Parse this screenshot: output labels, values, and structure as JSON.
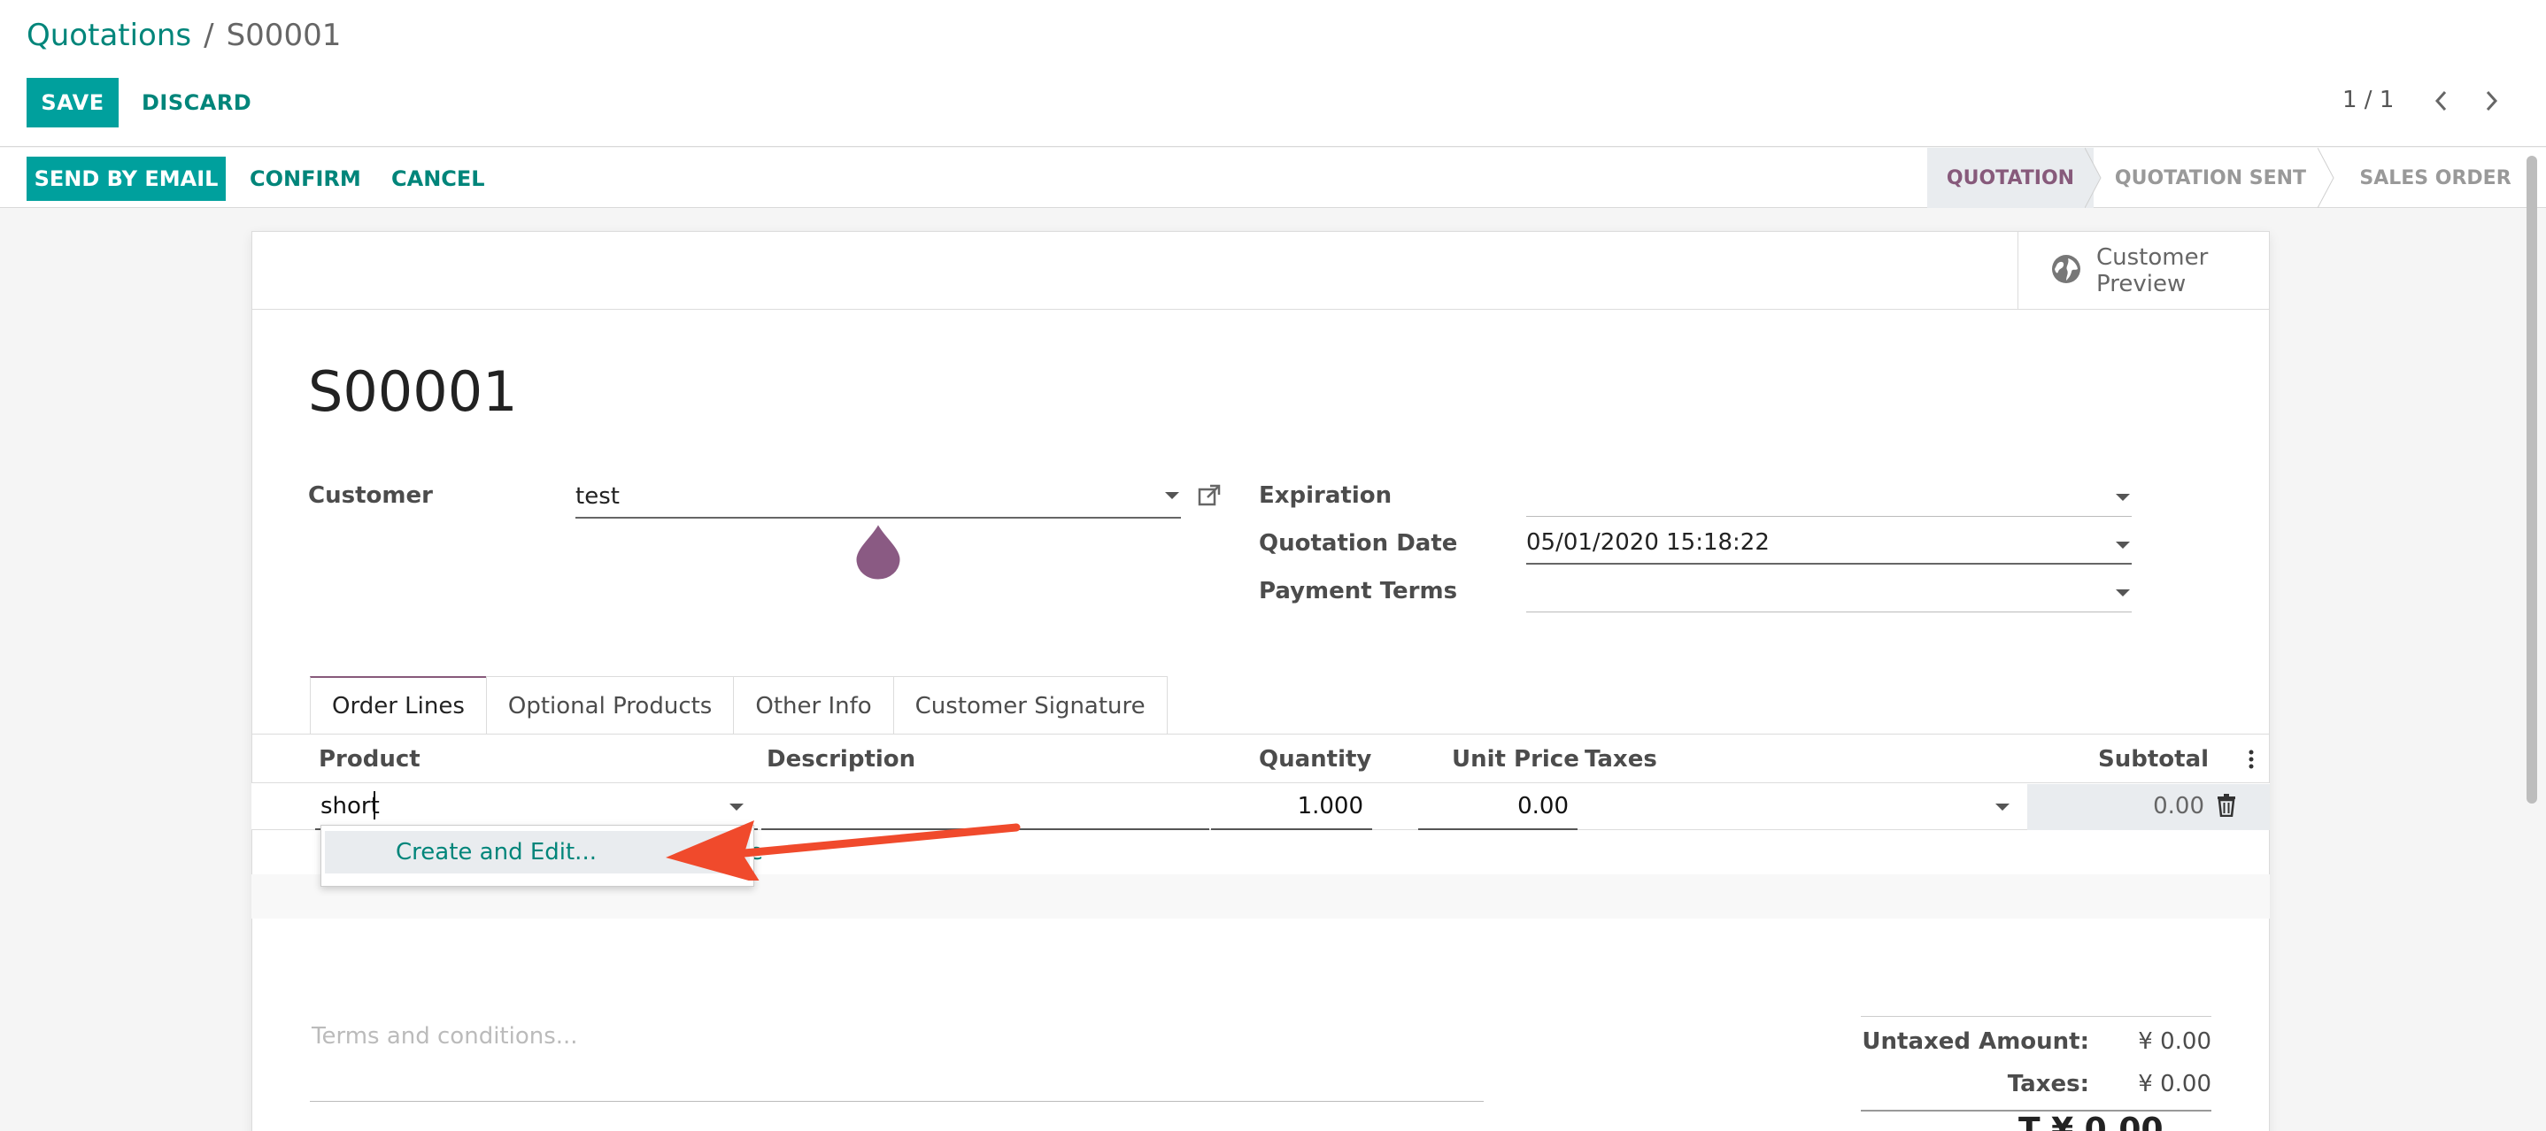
{
  "breadcrumb": {
    "parent": "Quotations",
    "separator": "/",
    "current": "S00001"
  },
  "toolbar": {
    "save": "SAVE",
    "discard": "DISCARD"
  },
  "pager": {
    "value": "1 / 1"
  },
  "actions": {
    "send_by_email": "SEND BY EMAIL",
    "confirm": "CONFIRM",
    "cancel": "CANCEL"
  },
  "stages": [
    {
      "label": "QUOTATION",
      "active": true
    },
    {
      "label": "QUOTATION SENT",
      "active": false
    },
    {
      "label": "SALES ORDER",
      "active": false
    }
  ],
  "smart_button": {
    "label_line1": "Customer",
    "label_line2": "Preview",
    "icon": "globe-icon"
  },
  "document": {
    "title": "S00001"
  },
  "form": {
    "customer_label": "Customer",
    "customer_value": "test",
    "expiration_label": "Expiration",
    "expiration_value": "",
    "quotation_date_label": "Quotation Date",
    "quotation_date_value": "05/01/2020 15:18:22",
    "payment_terms_label": "Payment Terms",
    "payment_terms_value": ""
  },
  "tabs": [
    "Order Lines",
    "Optional Products",
    "Other Info",
    "Customer Signature"
  ],
  "order_lines": {
    "columns": {
      "product": "Product",
      "description": "Description",
      "quantity": "Quantity",
      "unit_price": "Unit Price",
      "taxes": "Taxes",
      "subtotal": "Subtotal"
    },
    "row": {
      "product": "short",
      "description": "",
      "quantity": "1.000",
      "unit_price": "0.00",
      "taxes": "",
      "subtotal": "0.00"
    }
  },
  "autocomplete": {
    "item": "Create and Edit...",
    "behind_text": "e"
  },
  "footer": {
    "terms_placeholder": "Terms and conditions...",
    "untaxed_label": "Untaxed Amount:",
    "untaxed_value": "¥ 0.00",
    "taxes_label": "Taxes:",
    "taxes_value": "¥ 0.00",
    "total_partial": "T      ¥ 0.00"
  },
  "colors": {
    "primary": "#00a09d",
    "link": "#00857a",
    "brand": "#875a7b",
    "annotation_arrow": "#f04a2c"
  }
}
